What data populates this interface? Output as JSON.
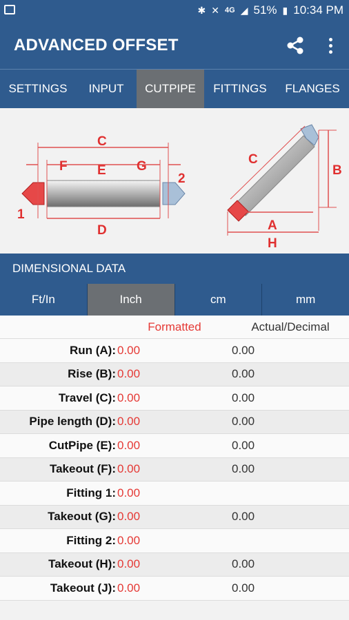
{
  "status_bar": {
    "battery": "51%",
    "time": "10:34 PM",
    "signal_label": "4G"
  },
  "app_bar": {
    "title": "ADVANCED OFFSET"
  },
  "tabs": [
    {
      "label": "SETTINGS"
    },
    {
      "label": "INPUT"
    },
    {
      "label": "CUTPIPE",
      "active": true
    },
    {
      "label": "FITTINGS"
    },
    {
      "label": "FLANGES"
    }
  ],
  "diagram": {
    "labels": [
      "C",
      "F",
      "E",
      "G",
      "D",
      "1",
      "2",
      "C",
      "B",
      "A",
      "H"
    ]
  },
  "section": {
    "title": "DIMENSIONAL DATA"
  },
  "units": [
    {
      "label": "Ft/In"
    },
    {
      "label": "Inch",
      "active": true
    },
    {
      "label": "cm"
    },
    {
      "label": "mm"
    }
  ],
  "table": {
    "headers": {
      "formatted": "Formatted",
      "decimal": "Actual/Decimal"
    },
    "rows": [
      {
        "label": "Run (A):",
        "formatted": "0.00",
        "decimal": "0.00"
      },
      {
        "label": "Rise (B):",
        "formatted": "0.00",
        "decimal": "0.00"
      },
      {
        "label": "Travel (C):",
        "formatted": "0.00",
        "decimal": "0.00"
      },
      {
        "label": "Pipe length (D):",
        "formatted": "0.00",
        "decimal": "0.00"
      },
      {
        "label": "CutPipe (E):",
        "formatted": "0.00",
        "decimal": "0.00"
      },
      {
        "label": "Takeout (F):",
        "formatted": "0.00",
        "decimal": "0.00"
      },
      {
        "label": "Fitting 1:",
        "formatted": "0.00",
        "decimal": ""
      },
      {
        "label": "Takeout (G):",
        "formatted": "0.00",
        "decimal": "0.00"
      },
      {
        "label": "Fitting 2:",
        "formatted": "0.00",
        "decimal": ""
      },
      {
        "label": "Takeout (H):",
        "formatted": "0.00",
        "decimal": "0.00"
      },
      {
        "label": "Takeout (J):",
        "formatted": "0.00",
        "decimal": "0.00"
      }
    ]
  }
}
